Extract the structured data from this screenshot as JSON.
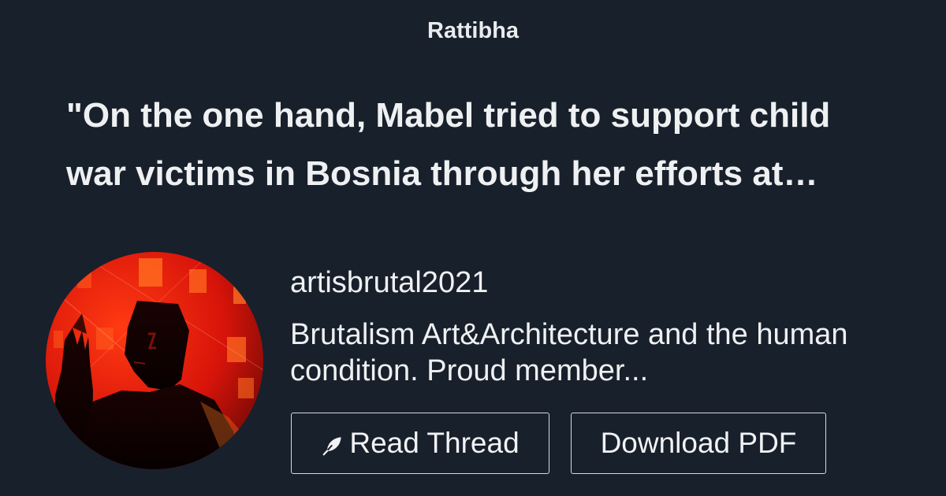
{
  "site": {
    "brand": "Rattibha"
  },
  "thread": {
    "title_lines": [
      "\"On the one hand, Mabel tried to support child",
      "war victims in Bosnia through her efforts at…"
    ]
  },
  "author": {
    "username": "artisbrutal2021",
    "bio_lines": [
      "Brutalism Art&Architecture and the human",
      "condition. Proud member..."
    ]
  },
  "actions": {
    "read_thread_label": "Read Thread",
    "read_thread_icon": "feather-icon",
    "download_pdf_label": "Download PDF"
  },
  "colors": {
    "background": "#18202b",
    "text": "#eef0f2",
    "button_border": "#d7dadd",
    "avatar_red": "#e01b0c",
    "avatar_orange": "#ff6a1f"
  }
}
